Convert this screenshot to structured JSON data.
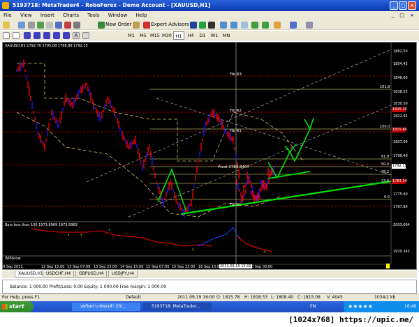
{
  "window": {
    "title": "5193718: MetaTrader4 - RoboForex - Demo Account - [XAUUSD,H1]"
  },
  "menu": [
    "File",
    "View",
    "Insert",
    "Charts",
    "Tools",
    "Window",
    "Help"
  ],
  "toolbar": {
    "new_order": "New Order",
    "expert_advisors": "Expert Advisors"
  },
  "timeframes": {
    "items": [
      "M1",
      "M5",
      "M15",
      "M30",
      "H1",
      "H4",
      "D1",
      "W1",
      "MN"
    ],
    "active": "H1"
  },
  "chart": {
    "info": "XAUUSD,H1  1792.70 1795.08 1788.88 1792.15",
    "indicator1_info": "Bars less than 100 1973.8969 1973.8969",
    "indicator2_info": "WPRslow",
    "price_axis": [
      "1862.50",
      "1854.45",
      "1846.60",
      "1838.55",
      "1830.50",
      "1822.65",
      "1814.60",
      "1807.00",
      "1799.40",
      "1791.35",
      "1783.60",
      "1775.60",
      "1767.80",
      "2003.604",
      "1970.342"
    ],
    "price_labels": {
      "red1": "1825.10",
      "red2": "1815.84",
      "white": "1792.15",
      "red3": "1783.34"
    },
    "time_axis": [
      "9 Sep 2011",
      "12 Sep 15:00",
      "13 Sep 07:00",
      "13 Sep 23:00",
      "14 Sep 15:00",
      "15 Sep 07:00",
      "15 Sep 23:00",
      "16 Sep 15:00",
      "2011.09.19 15:00",
      "0 Sep 00:00"
    ],
    "fib_labels": {
      "r3": "Fib R3",
      "r2": "Fib R2",
      "r1": "Fib R1",
      "pivot": "Pivot  1783.8407",
      "s1": "Fib S1"
    },
    "level_labels": [
      "161.8",
      "100.0",
      "61.8",
      "50.0",
      "38.2",
      "23.6",
      "0.0"
    ],
    "colors": {
      "background": "#000000",
      "bull": "#1a1aff",
      "bear": "#ff0000",
      "drawn_lines": "#00e000",
      "fib_lines": "#ffff80",
      "pivot_lines": "#c00000"
    }
  },
  "tabs": {
    "items": [
      "XAUUSD,H1",
      "USDCHF,H4",
      "GBPUSD,H4",
      "USDJPY,H4"
    ],
    "active": "XAUUSD,H1"
  },
  "terminal": {
    "balance": "Balance: 1 000.00  Profit/Loss: 0.00  Equity: 1 000.00  Free margin: 1 000.00"
  },
  "status": {
    "help": "For Help, press F1",
    "profile": "Default",
    "datetime": "2011.09.19 16:00",
    "open": "O: 1815.78",
    "high": "H: 1818.53",
    "low": "L: 1808.40",
    "close": "C: 1815.08",
    "volume": "V: 4045",
    "traffic": "1034/1 kb"
  },
  "taskbar": {
    "start": "start",
    "tasks": [
      "บทวิเคราะห์ทองคำ 20/...",
      "5193718: MetaTrader..."
    ],
    "lang": "EN",
    "clock": "16:40"
  },
  "watermark": "[1024x768] https://upic.me/"
}
